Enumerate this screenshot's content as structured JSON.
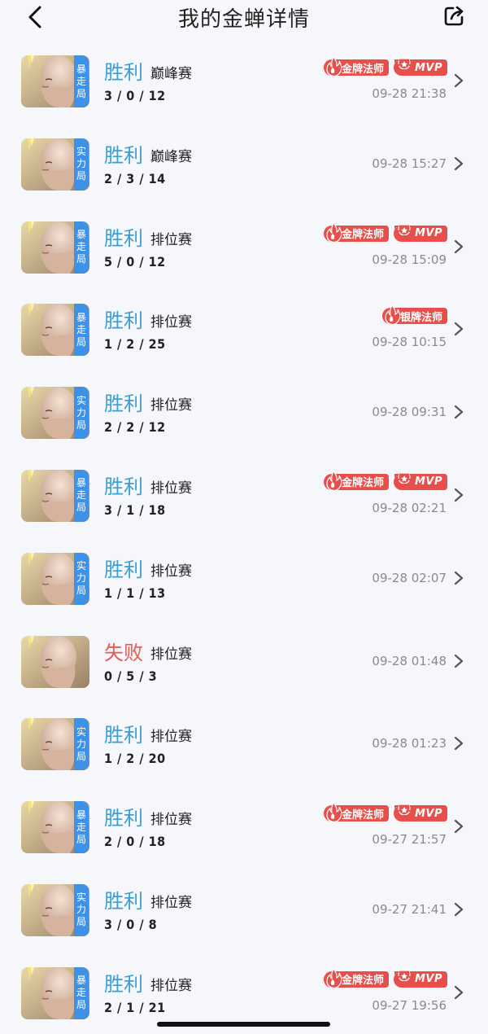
{
  "header": {
    "title": "我的金蝉详情",
    "back_icon": "chevron-left-icon",
    "share_icon": "share-icon"
  },
  "colors": {
    "win": "#3b9fd5",
    "lose": "#e65b53",
    "tag": "#3d91e6",
    "badge": "#e84f4a",
    "background": "#f6f7fb"
  },
  "matches": [
    {
      "result": "胜利",
      "type": "巅峰赛",
      "kda": "3 / 0 / 12",
      "tag": [
        "暴",
        "走",
        "局"
      ],
      "badges": [
        "金牌法师",
        "MVP"
      ],
      "time": "09-28 21:38"
    },
    {
      "result": "胜利",
      "type": "巅峰赛",
      "kda": "2 / 3 / 14",
      "tag": [
        "实",
        "力",
        "局"
      ],
      "badges": [],
      "time": "09-28 15:27"
    },
    {
      "result": "胜利",
      "type": "排位赛",
      "kda": "5 / 0 / 12",
      "tag": [
        "暴",
        "走",
        "局"
      ],
      "badges": [
        "金牌法师",
        "MVP"
      ],
      "time": "09-28 15:09"
    },
    {
      "result": "胜利",
      "type": "排位赛",
      "kda": "1 / 2 / 25",
      "tag": [
        "暴",
        "走",
        "局"
      ],
      "badges": [
        "银牌法师"
      ],
      "time": "09-28 10:15"
    },
    {
      "result": "胜利",
      "type": "排位赛",
      "kda": "2 / 2 / 12",
      "tag": [
        "实",
        "力",
        "局"
      ],
      "badges": [],
      "time": "09-28 09:31"
    },
    {
      "result": "胜利",
      "type": "排位赛",
      "kda": "3 / 1 / 18",
      "tag": [
        "暴",
        "走",
        "局"
      ],
      "badges": [
        "金牌法师",
        "MVP"
      ],
      "time": "09-28 02:21"
    },
    {
      "result": "胜利",
      "type": "排位赛",
      "kda": "1 / 1 / 13",
      "tag": [
        "实",
        "力",
        "局"
      ],
      "badges": [],
      "time": "09-28 02:07"
    },
    {
      "result": "失败",
      "type": "排位赛",
      "kda": "0 / 5 / 3",
      "tag": [],
      "badges": [],
      "time": "09-28 01:48"
    },
    {
      "result": "胜利",
      "type": "排位赛",
      "kda": "1 / 2 / 20",
      "tag": [
        "实",
        "力",
        "局"
      ],
      "badges": [],
      "time": "09-28 01:23"
    },
    {
      "result": "胜利",
      "type": "排位赛",
      "kda": "2 / 0 / 18",
      "tag": [
        "暴",
        "走",
        "局"
      ],
      "badges": [
        "金牌法师",
        "MVP"
      ],
      "time": "09-27 21:57"
    },
    {
      "result": "胜利",
      "type": "排位赛",
      "kda": "3 / 0 / 8",
      "tag": [
        "实",
        "力",
        "局"
      ],
      "badges": [],
      "time": "09-27 21:41"
    },
    {
      "result": "胜利",
      "type": "排位赛",
      "kda": "2 / 1 / 21",
      "tag": [
        "暴",
        "走",
        "局"
      ],
      "badges": [
        "金牌法师",
        "MVP"
      ],
      "time": "09-27 19:56"
    }
  ]
}
